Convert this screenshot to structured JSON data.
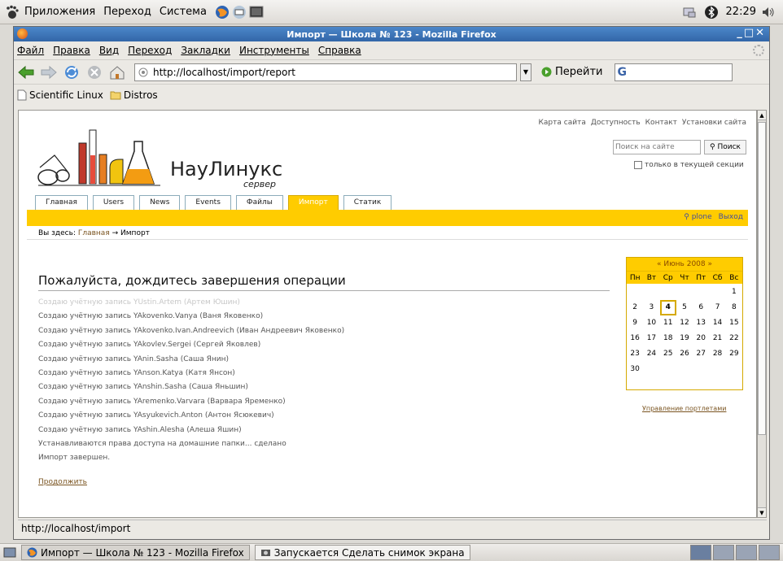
{
  "top_panel": {
    "menus": [
      "Приложения",
      "Переход",
      "Система"
    ],
    "clock": "22:29"
  },
  "window": {
    "title": "Импорт — Школа № 123 - Mozilla Firefox",
    "controls": "_□✕"
  },
  "menubar": {
    "items": [
      "Файл",
      "Правка",
      "Вид",
      "Переход",
      "Закладки",
      "Инструменты",
      "Справка"
    ]
  },
  "navbar": {
    "url": "http://localhost/import/report",
    "go_label": "Перейти"
  },
  "bookmarks": {
    "items": [
      "Scientific Linux",
      "Distros"
    ]
  },
  "site": {
    "actions": [
      "Карта сайта",
      "Доступность",
      "Контакт",
      "Установки сайта"
    ],
    "logo_text": "НауЛинукс",
    "logo_subtext": "сервер",
    "search_placeholder": "Поиск на сайте",
    "search_button": "Поиск",
    "search_section_only": "только в текущей секции",
    "tabs": [
      "Главная",
      "Users",
      "News",
      "Events",
      "Файлы",
      "Импорт",
      "Статик"
    ],
    "active_tab": "Импорт",
    "user": "plone",
    "logout": "Выход",
    "breadcrumb_prefix": "Вы здесь:",
    "breadcrumb_home": "Главная",
    "breadcrumb_arrow": "→",
    "breadcrumb_current": "Импорт"
  },
  "main": {
    "title": "Пожалуйста, дождитесь завершения операции",
    "log_faded": "Создаю учётную запись YUstin.Artem (Артем Юшин)",
    "log": [
      "Создаю учётную запись YAkovenko.Vanya (Ваня Яковенко)",
      "Создаю учётную запись YAkovenko.Ivan.Andreevich (Иван Андреевич Яковенко)",
      "Создаю учётную запись YAkovlev.Sergei (Сергей Яковлев)",
      "Создаю учётную запись YAnin.Sasha (Саша Янин)",
      "Создаю учётную запись YAnson.Katya (Катя Янсон)",
      "Создаю учётную запись YAnshin.Sasha (Саша Яньшин)",
      "Создаю учётную запись YAremenko.Varvara (Варвара Яременко)",
      "Создаю учётную запись YAsyukevich.Anton (Антон Ясюкевич)",
      "Создаю учётную запись YAshin.Alesha (Алеша Яшин)",
      "Устанавливаются права доступа на домашние папки... сделано",
      "Импорт завершен."
    ],
    "continue_link": "Продолжить"
  },
  "calendar": {
    "header": "« Июнь 2008 »",
    "weekdays": [
      "Пн",
      "Вт",
      "Ср",
      "Чт",
      "Пт",
      "Сб",
      "Вс"
    ],
    "cells": [
      "",
      "",
      "",
      "",
      "",
      "",
      "1",
      "2",
      "3",
      "4",
      "5",
      "6",
      "7",
      "8",
      "9",
      "10",
      "11",
      "12",
      "13",
      "14",
      "15",
      "16",
      "17",
      "18",
      "19",
      "20",
      "21",
      "22",
      "23",
      "24",
      "25",
      "26",
      "27",
      "28",
      "29",
      "30",
      "",
      "",
      "",
      "",
      "",
      ""
    ],
    "today": "4",
    "portlet_management": "Управление портлетами"
  },
  "statusbar": {
    "text": "http://localhost/import"
  },
  "taskbar": {
    "tasks": [
      "Импорт — Школа № 123 - Mozilla Firefox",
      "Запускается Сделать снимок экрана"
    ]
  }
}
